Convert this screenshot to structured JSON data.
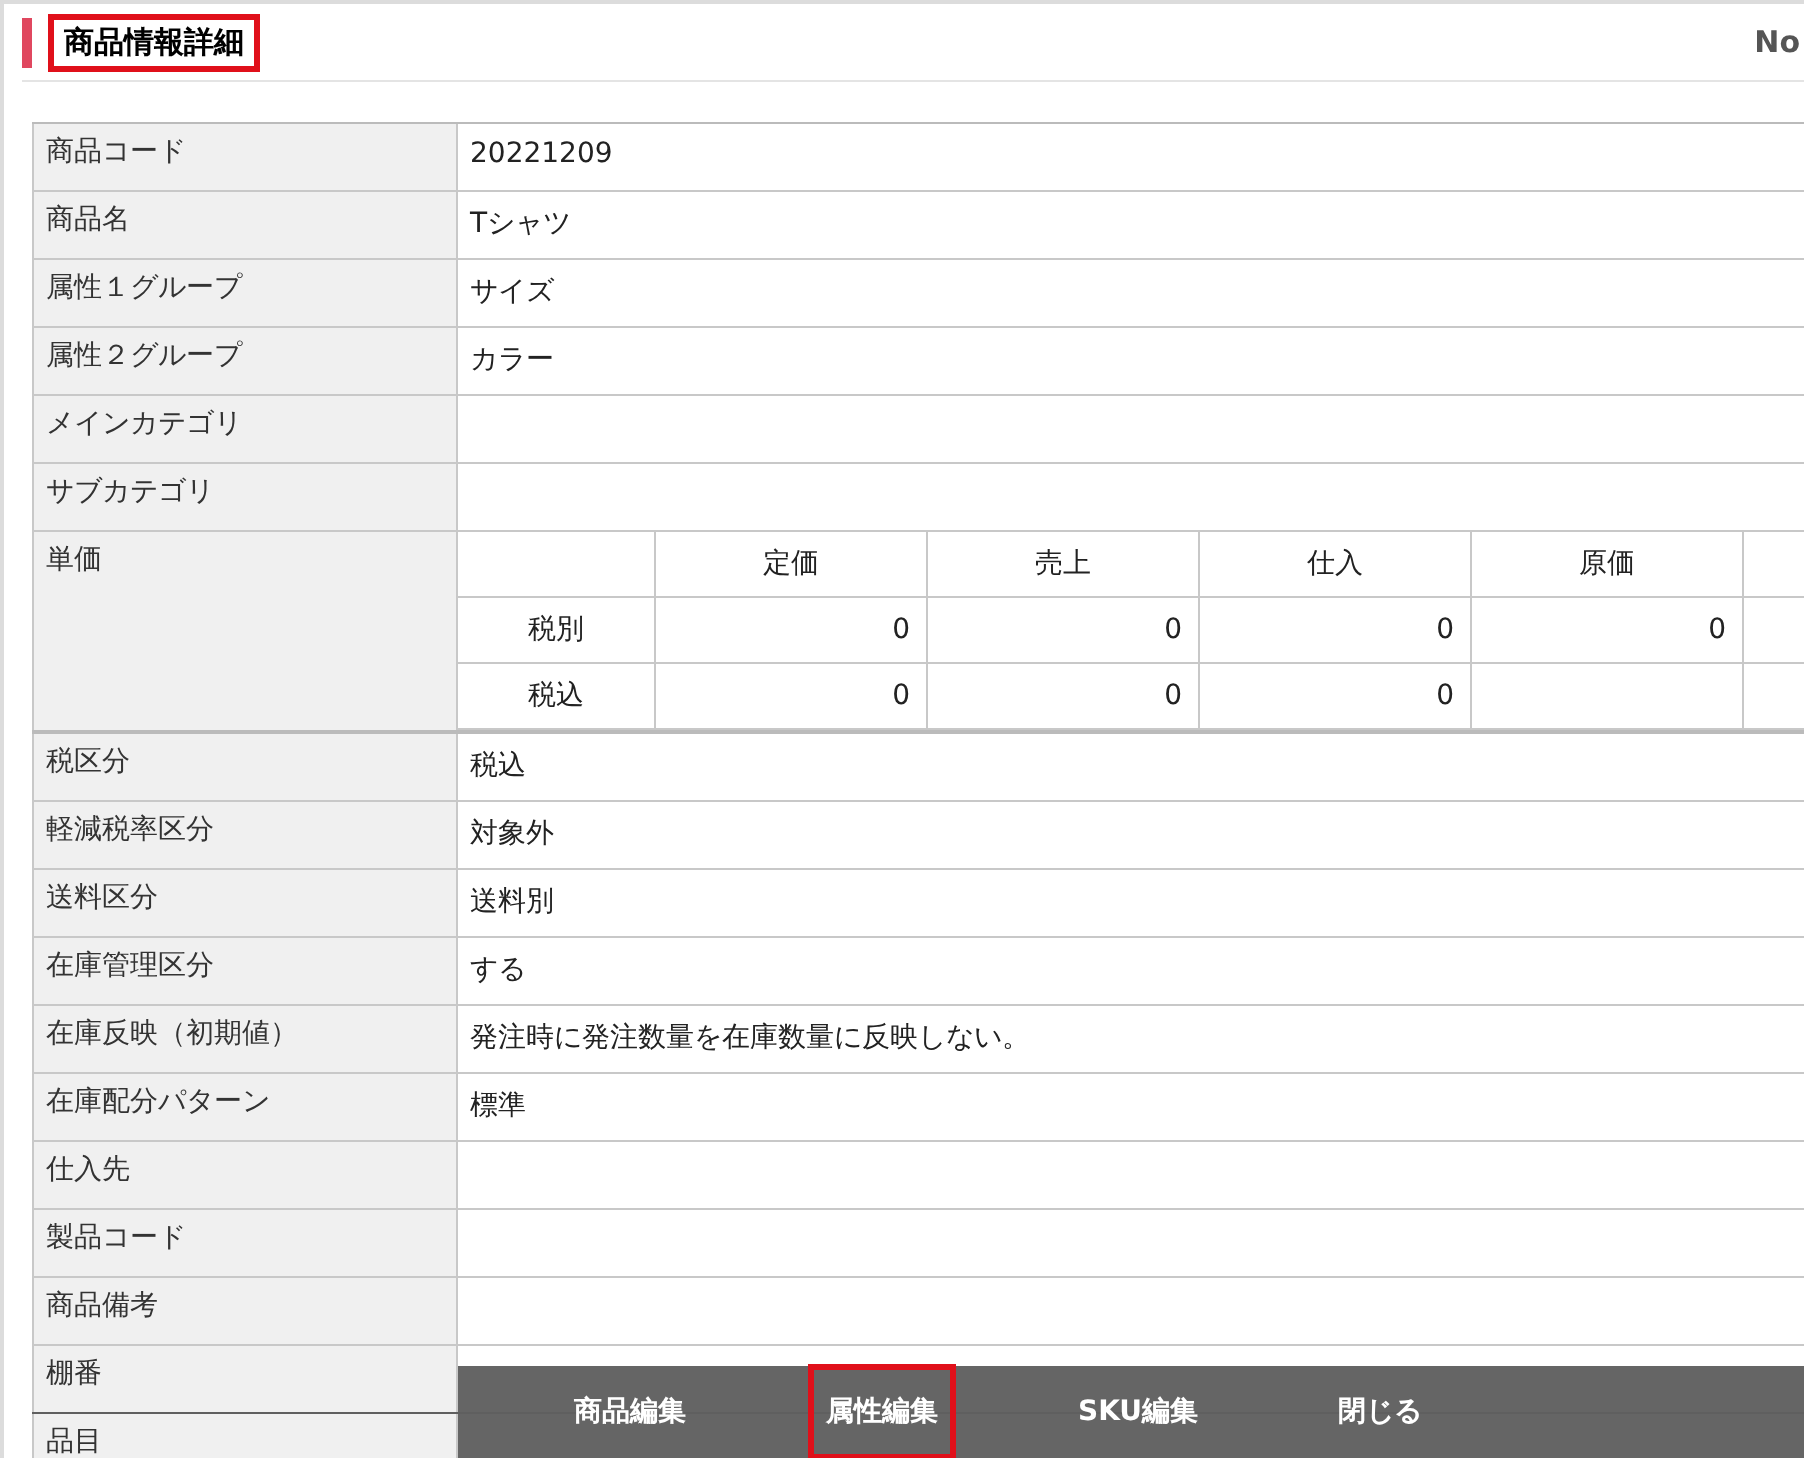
{
  "header": {
    "title": "商品情報詳細",
    "title_highlighted": true,
    "right_text": "No"
  },
  "rows": [
    {
      "kind": "text",
      "label": "商品コード",
      "value": "20221209"
    },
    {
      "kind": "text",
      "label": "商品名",
      "value": "Tシャツ"
    },
    {
      "kind": "text",
      "label": "属性１グループ",
      "value": "サイズ"
    },
    {
      "kind": "text",
      "label": "属性２グループ",
      "value": "カラー"
    },
    {
      "kind": "text",
      "label": "メインカテゴリ"
    },
    {
      "kind": "text",
      "label": "サブカテゴリ"
    },
    {
      "kind": "price",
      "label": "単価",
      "columns": [
        "定価",
        "売上",
        "仕入",
        "原価"
      ],
      "price_rows": [
        {
          "label": "税別",
          "values": [
            "0",
            "0",
            "0",
            "0"
          ]
        },
        {
          "label": "税込",
          "values": [
            "0",
            "0",
            "0"
          ]
        }
      ]
    },
    {
      "kind": "text",
      "label": "税区分",
      "value": "税込"
    },
    {
      "kind": "text",
      "label": "軽減税率区分",
      "value": "対象外"
    },
    {
      "kind": "text",
      "label": "送料区分",
      "value": "送料別"
    },
    {
      "kind": "text",
      "label": "在庫管理区分",
      "value": "する"
    },
    {
      "kind": "text",
      "label": "在庫反映（初期値）",
      "value": "発注時に発注数量を在庫数量に反映しない。"
    },
    {
      "kind": "text",
      "label": "在庫配分パターン",
      "value": "標準"
    },
    {
      "kind": "text",
      "label": "仕入先"
    },
    {
      "kind": "text",
      "label": "製品コード"
    },
    {
      "kind": "text",
      "label": "商品備考"
    },
    {
      "kind": "text",
      "label": "棚番"
    },
    {
      "kind": "text",
      "label": "品目"
    }
  ],
  "buttons": [
    {
      "label": "商品編集",
      "highlighted": false
    },
    {
      "label": "属性編集",
      "highlighted": true
    },
    {
      "label": "SKU編集",
      "highlighted": false
    },
    {
      "label": "閉じる",
      "highlighted": false
    }
  ]
}
